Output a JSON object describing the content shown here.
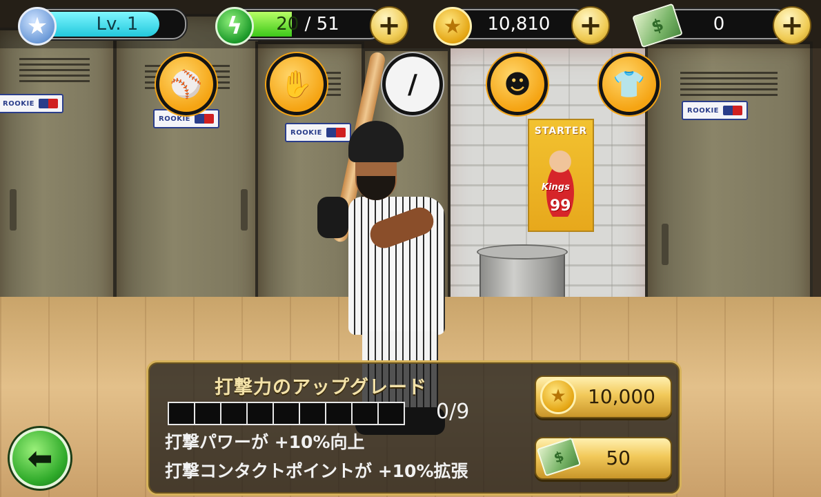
{
  "hud": {
    "level": {
      "label": "Lv. 1",
      "fill_fraction": 0.82
    },
    "energy": {
      "current": "20",
      "separator": "/",
      "max": "51",
      "fill_fraction": 0.39
    },
    "coins": {
      "value": "10,810"
    },
    "cash": {
      "value": "0"
    },
    "plus_symbol": "+",
    "icons": {
      "level": "star-icon",
      "energy": "lightning-icon",
      "coins": "coin-icon",
      "cash": "cash-icon"
    }
  },
  "equipment_tabs": [
    {
      "name": "ball-icon",
      "glyph": "⚾"
    },
    {
      "name": "glove-icon",
      "glyph": "✋"
    },
    {
      "name": "bat-icon",
      "glyph": "∕"
    },
    {
      "name": "face-icon",
      "glyph": "☻"
    },
    {
      "name": "jersey-icon",
      "glyph": "👕"
    }
  ],
  "scene": {
    "locker_badge": "ROOKIE",
    "poster": {
      "title": "STARTER",
      "team": "Kings",
      "number": "99"
    }
  },
  "upgrade": {
    "title": "打撃力のアップグレード",
    "progress": {
      "current": 0,
      "max": 9,
      "text": "0/9"
    },
    "effects": [
      "打撃パワーが +10%向上",
      "打撃コンタクトポイントが +10%拡張"
    ],
    "price_coins": "10,000",
    "price_cash": "50"
  },
  "back_button": {
    "icon": "arrow-left-icon",
    "glyph": "⬅"
  },
  "colors": {
    "accent_gold": "#f2c95a",
    "level_bar": "#22c8dc",
    "energy_bar": "#3cc81a",
    "panel_border": "#d6b25a"
  }
}
